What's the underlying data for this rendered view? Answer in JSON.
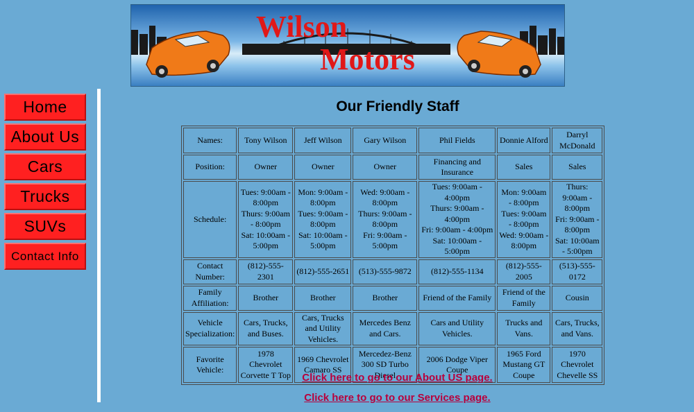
{
  "banner": {
    "line1": "Wilson",
    "line2": "Motors",
    "title_color": "#e01818",
    "car_color": "#f07a18"
  },
  "nav": {
    "items": [
      {
        "label": "Home"
      },
      {
        "label": "About Us"
      },
      {
        "label": "Cars"
      },
      {
        "label": "Trucks"
      },
      {
        "label": "SUVs"
      },
      {
        "label": "Contact Info"
      }
    ],
    "button_color": "#ff2020"
  },
  "page": {
    "title": "Our Friendly Staff"
  },
  "staff_table": {
    "row_labels": [
      "Names:",
      "Position:",
      "Schedule:",
      "Contact Number:",
      "Family Affiliation:",
      "Vehicle Specialization:",
      "Favorite Vehicle:"
    ],
    "staff": [
      {
        "name": "Tony Wilson",
        "position": "Owner",
        "schedule": [
          "Tues: 9:00am - 8:00pm",
          "Thurs: 9:00am - 8:00pm",
          "Sat: 10:00am - 5:00pm"
        ],
        "contact": "(812)-555-2301",
        "family": "Brother",
        "specialization": "Cars, Trucks, and Buses.",
        "favorite": "1978 Chevrolet Corvette T Top"
      },
      {
        "name": "Jeff Wilson",
        "position": "Owner",
        "schedule": [
          "Mon: 9:00am - 8:00pm",
          "Tues: 9:00am - 8:00pm",
          "Sat: 10:00am - 5:00pm"
        ],
        "contact": "(812)-555-2651",
        "family": "Brother",
        "specialization": "Cars, Trucks and Utility Vehicles.",
        "favorite": "1969 Chevrolet Camaro SS"
      },
      {
        "name": "Gary Wilson",
        "position": "Owner",
        "schedule": [
          "Wed: 9:00am - 8:00pm",
          "Thurs: 9:00am - 8:00pm",
          "Fri: 9:00am - 5:00pm"
        ],
        "contact": "(513)-555-9872",
        "family": "Brother",
        "specialization": "Mercedes Benz and Cars.",
        "favorite": "Mercedez-Benz 300 SD Turbo Diesel"
      },
      {
        "name": "Phil Fields",
        "position": "Financing and Insurance",
        "schedule": [
          "Tues: 9:00am - 4:00pm",
          "Thurs: 9:00am - 4:00pm",
          "Fri: 9:00am - 4:00pm",
          "Sat: 10:00am - 5:00pm"
        ],
        "contact": "(812)-555-1134",
        "family": "Friend of the Family",
        "specialization": "Cars and Utility Vehicles.",
        "favorite": "2006 Dodge Viper Coupe"
      },
      {
        "name": "Donnie Alford",
        "position": "Sales",
        "schedule": [
          "Mon: 9:00am - 8:00pm",
          "Tues: 9:00am - 8:00pm",
          "Wed: 9:00am - 8:00pm"
        ],
        "contact": "(812)-555-2005",
        "family": "Friend of the Family",
        "specialization": "Trucks and Vans.",
        "favorite": "1965 Ford Mustang GT Coupe"
      },
      {
        "name": "Darryl McDonald",
        "position": "Sales",
        "schedule": [
          "Thurs: 9:00am - 8:00pm",
          "Fri: 9:00am - 8:00pm",
          "Sat: 10:00am - 5:00pm"
        ],
        "contact": "(513)-555-0172",
        "family": "Cousin",
        "specialization": "Cars, Trucks, and Vans.",
        "favorite": "1970 Chevrolet Chevelle SS"
      }
    ]
  },
  "links": [
    {
      "text": "Click here to go to our About US page."
    },
    {
      "text": "Click here to go to our Services page."
    }
  ]
}
